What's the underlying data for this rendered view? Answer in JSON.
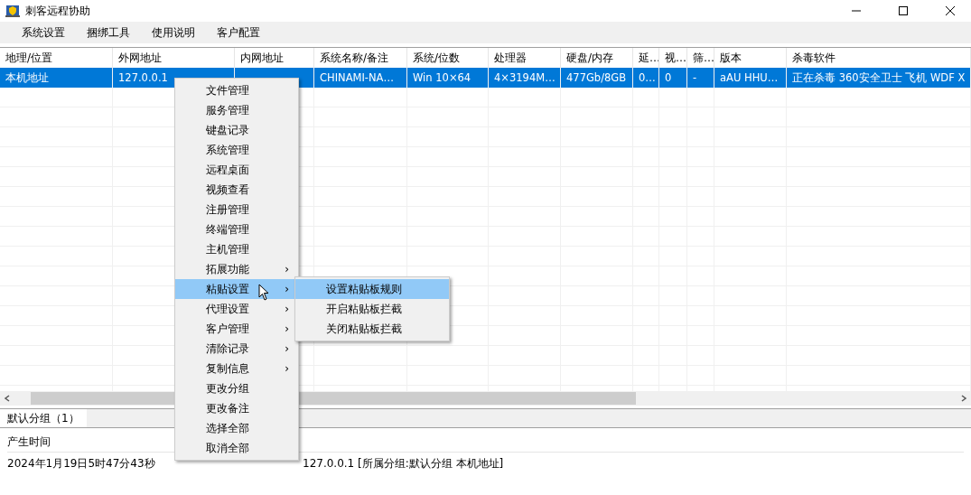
{
  "window": {
    "title": "刺客远程协助"
  },
  "menubar": [
    {
      "label": "系统设置"
    },
    {
      "label": "捆绑工具"
    },
    {
      "label": "使用说明"
    },
    {
      "label": "客户配置"
    }
  ],
  "table": {
    "columns": [
      "地理/位置",
      "外网地址",
      "内网地址",
      "系统名称/备注",
      "系统/位数",
      "处理器",
      "硬盘/内存",
      "延…",
      "视…",
      "筛…",
      "版本",
      "杀毒软件"
    ],
    "rows": [
      {
        "selected": true,
        "cells": [
          "本机地址",
          "127.0.0.1",
          "",
          "CHINAMI-NA…",
          "Win 10×64",
          "4×3194M…",
          "477Gb/8GB",
          "0…",
          "0",
          "-",
          "aAU HHU…",
          "正在杀毒 360安全卫士 飞机 WDF X"
        ]
      }
    ]
  },
  "group_tabs": [
    {
      "label": "默认分组（1）",
      "selected": true
    }
  ],
  "log": {
    "header": "产生时间",
    "entries": [
      {
        "time": "2024年1月19日5时47分43秒",
        "message": "127.0.0.1  [所属分组:默认分组    本机地址]"
      }
    ]
  },
  "context_menu": {
    "items": [
      {
        "label": "文件管理",
        "submenu": false,
        "selected": false
      },
      {
        "label": "服务管理",
        "submenu": false,
        "selected": false
      },
      {
        "label": "键盘记录",
        "submenu": false,
        "selected": false
      },
      {
        "label": "系统管理",
        "submenu": false,
        "selected": false
      },
      {
        "label": "远程桌面",
        "submenu": false,
        "selected": false
      },
      {
        "label": "视频查看",
        "submenu": false,
        "selected": false
      },
      {
        "label": "注册管理",
        "submenu": false,
        "selected": false
      },
      {
        "label": "终端管理",
        "submenu": false,
        "selected": false
      },
      {
        "label": "主机管理",
        "submenu": false,
        "selected": false
      },
      {
        "label": "拓展功能",
        "submenu": true,
        "selected": false
      },
      {
        "label": "粘贴设置",
        "submenu": true,
        "selected": true
      },
      {
        "label": "代理设置",
        "submenu": true,
        "selected": false
      },
      {
        "label": "客户管理",
        "submenu": true,
        "selected": false
      },
      {
        "label": "清除记录",
        "submenu": true,
        "selected": false
      },
      {
        "label": "复制信息",
        "submenu": true,
        "selected": false
      },
      {
        "label": "更改分组",
        "submenu": false,
        "selected": false
      },
      {
        "label": "更改备注",
        "submenu": false,
        "selected": false
      },
      {
        "label": "选择全部",
        "submenu": false,
        "selected": false
      },
      {
        "label": "取消全部",
        "submenu": false,
        "selected": false
      }
    ],
    "arrow": "›",
    "submenu": [
      {
        "label": "设置粘贴板规则",
        "selected": true
      },
      {
        "label": "开启粘贴板拦截",
        "selected": false
      },
      {
        "label": "关闭粘贴板拦截",
        "selected": false
      }
    ]
  }
}
